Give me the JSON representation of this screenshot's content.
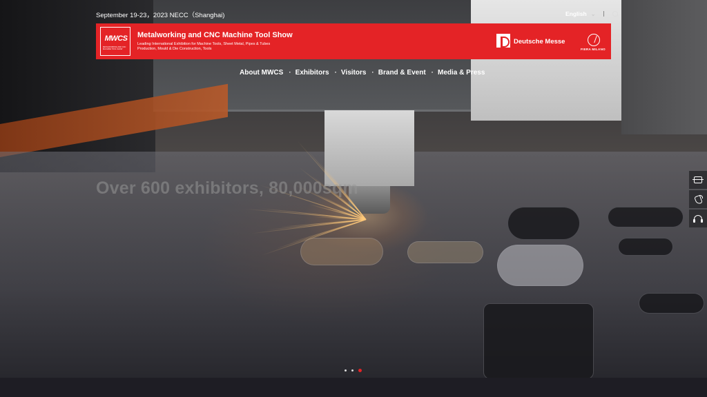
{
  "topbar": {
    "event_info": "September 19-23，2023 NECC（Shanghai)",
    "language": "English"
  },
  "banner": {
    "logo_text": "MWCS",
    "logo_sub": "METALWORKING AND CNC MACHINE TOOL SHOW",
    "title": "Metalworking and CNC Machine Tool Show",
    "subtitle": "Leading International Exhibition for Machine Tools, Sheet Metal, Pipes & Tubes Production, Mould & Die Construction, Tools",
    "partner1": "Deutsche Messe",
    "partner2": "FIERA MILANO"
  },
  "nav": {
    "items": [
      {
        "label": "About MWCS"
      },
      {
        "label": "Exhibitors"
      },
      {
        "label": "Visitors"
      },
      {
        "label": "Brand & Event"
      },
      {
        "label": "Media & Press"
      }
    ]
  },
  "hero": {
    "slogan": "Over 600 exhibitors, 80,000sqm",
    "slides": 3,
    "active_slide": 3
  },
  "side_tools": {
    "icons": [
      "scan-icon",
      "phone-icon",
      "headset-icon"
    ]
  },
  "colors": {
    "brand_red": "#e42326",
    "page_bg": "#1e1d24"
  }
}
